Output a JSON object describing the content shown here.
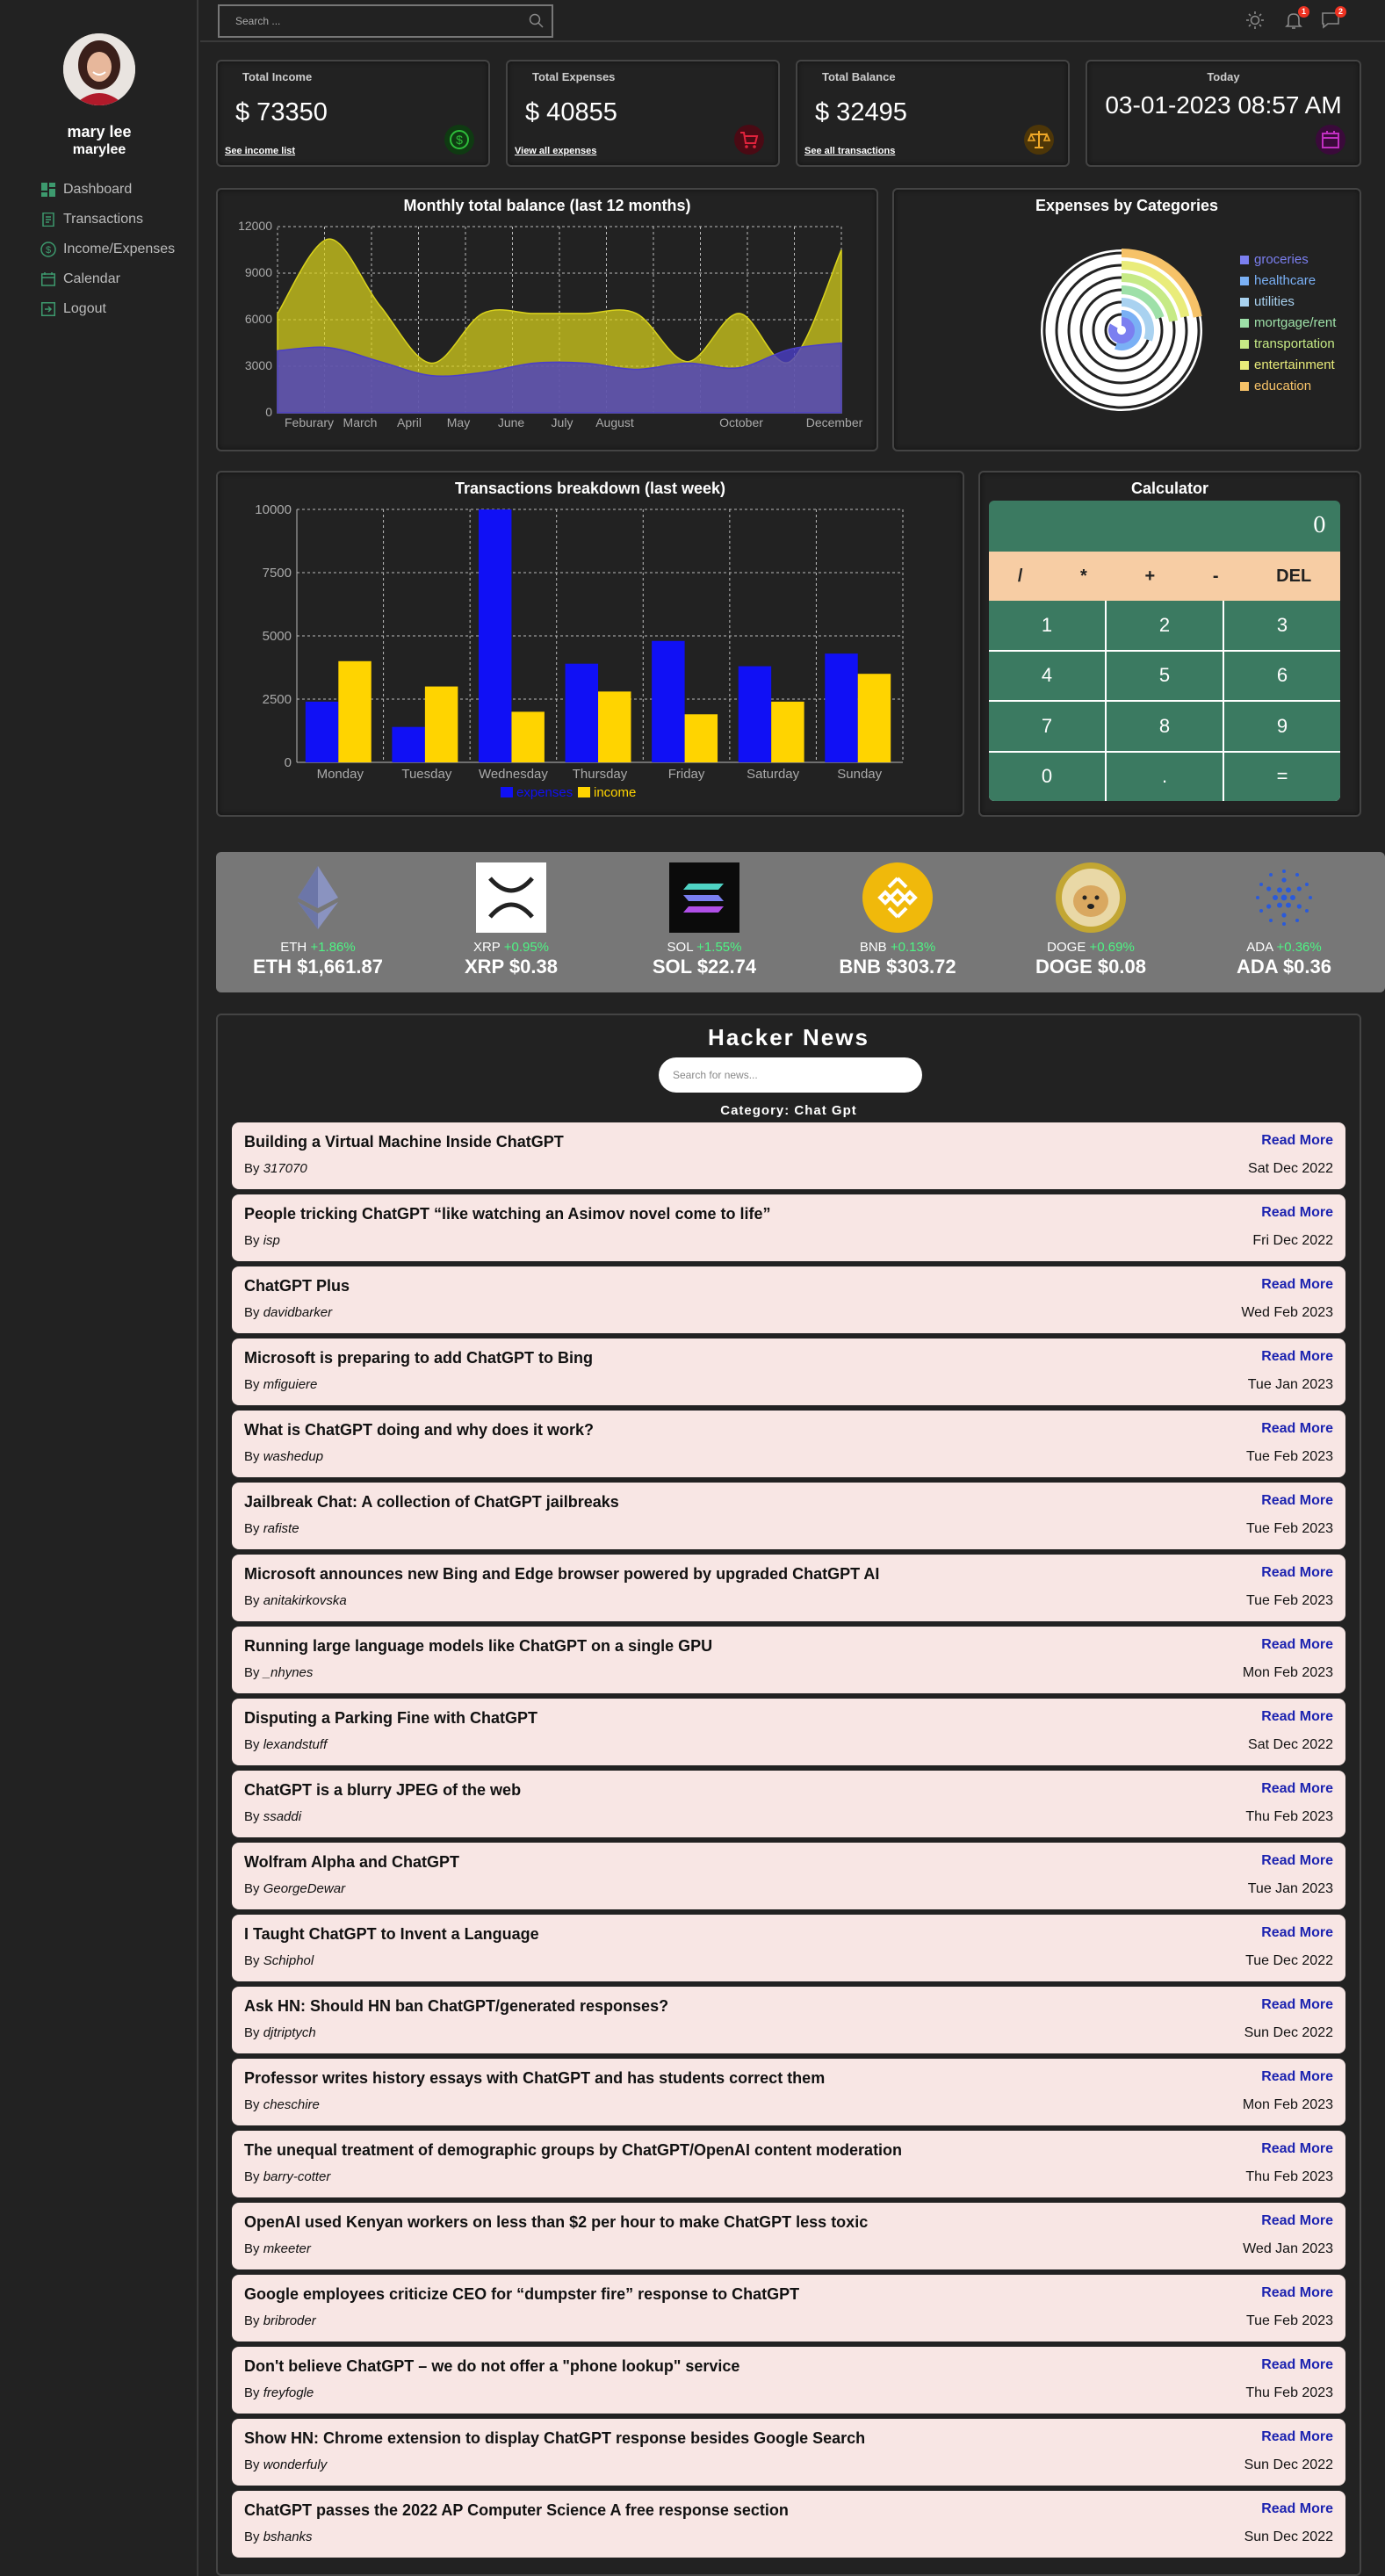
{
  "user": {
    "name": "mary lee",
    "handle": "marylee"
  },
  "sidebar": {
    "items": [
      {
        "label": "Dashboard",
        "icon": "dashboard-icon"
      },
      {
        "label": "Transactions",
        "icon": "receipt-icon"
      },
      {
        "label": "Income/Expenses",
        "icon": "dollar-circle-icon"
      },
      {
        "label": "Calendar",
        "icon": "calendar-icon"
      },
      {
        "label": "Logout",
        "icon": "logout-icon"
      }
    ]
  },
  "topbar": {
    "search_placeholder": "Search ...",
    "notifications_count": "1",
    "messages_count": "2"
  },
  "stats": {
    "income": {
      "title": "Total Income",
      "value": "$ 73350",
      "link": "See income list",
      "color": "#1f8a2a"
    },
    "expenses": {
      "title": "Total Expenses",
      "value": "$ 40855",
      "link": "View all expenses",
      "color": "#b8122b"
    },
    "balance": {
      "title": "Total Balance",
      "value": "$ 32495",
      "link": "See all transactions",
      "color": "#b57c12"
    },
    "today": {
      "title": "Today",
      "value": "03-01-2023 08:57 AM",
      "color": "#8a1a8a"
    }
  },
  "balance_chart": {
    "title": "Monthly total balance (last 12 months)"
  },
  "categories_chart": {
    "title": "Expenses by Categories"
  },
  "transactions_chart": {
    "title": "Transactions breakdown (last week)"
  },
  "chart_data": [
    {
      "type": "area",
      "title": "Monthly total balance (last 12 months)",
      "x": [
        "Feburary",
        "March",
        "April",
        "May",
        "June",
        "July",
        "August",
        "",
        "October",
        "",
        "December"
      ],
      "ylim": [
        0,
        12000
      ],
      "yticks": [
        0,
        3000,
        6000,
        9000,
        12000
      ],
      "grid": true,
      "series": [
        {
          "color": "#d9d21c",
          "values": [
            6400,
            11200,
            6900,
            3200,
            6400,
            6400,
            6400,
            6400,
            3300,
            6400,
            3300,
            10500
          ]
        },
        {
          "color": "#4b3fc7",
          "values": [
            4000,
            4200,
            3300,
            2400,
            2600,
            3200,
            3200,
            2800,
            3200,
            2900,
            4100,
            4500
          ]
        }
      ]
    },
    {
      "type": "pie",
      "title": "Expenses by Categories",
      "legend_position": "right",
      "series": [
        {
          "name": "groceries",
          "color": "#7b7ff0"
        },
        {
          "name": "healthcare",
          "color": "#7ab0f5"
        },
        {
          "name": "utilities",
          "color": "#a9d2f0"
        },
        {
          "name": "mortgage/rent",
          "color": "#9ee0a8"
        },
        {
          "name": "transportation",
          "color": "#c6ea85"
        },
        {
          "name": "entertainment",
          "color": "#e9ec7a"
        },
        {
          "name": "education",
          "color": "#f6c268"
        }
      ]
    },
    {
      "type": "bar",
      "title": "Transactions breakdown (last week)",
      "categories": [
        "Monday",
        "Tuesday",
        "Wednesday",
        "Thursday",
        "Friday",
        "Saturday",
        "Sunday"
      ],
      "ylim": [
        0,
        10000
      ],
      "yticks": [
        0,
        2500,
        5000,
        7500,
        10000
      ],
      "legend_position": "bottom",
      "series": [
        {
          "name": "expenses",
          "color": "#1010f5",
          "values": [
            2400,
            1400,
            10000,
            3900,
            4800,
            3800,
            4300
          ]
        },
        {
          "name": "income",
          "color": "#ffd400",
          "values": [
            4000,
            3000,
            2000,
            2800,
            1900,
            2400,
            3500
          ]
        }
      ]
    }
  ],
  "calculator": {
    "title": "Calculator",
    "display": "0",
    "ops": [
      "/",
      "*",
      "+",
      "-",
      "DEL"
    ],
    "keys": [
      "1",
      "2",
      "3",
      "4",
      "5",
      "6",
      "7",
      "8",
      "9",
      "0",
      ".",
      "="
    ]
  },
  "crypto": [
    {
      "symbol": "ETH",
      "change": "+1.86%",
      "price": "ETH $1,661.87",
      "icon": "ethereum-icon"
    },
    {
      "symbol": "XRP",
      "change": "+0.95%",
      "price": "XRP $0.38",
      "icon": "xrp-icon"
    },
    {
      "symbol": "SOL",
      "change": "+1.55%",
      "price": "SOL $22.74",
      "icon": "solana-icon"
    },
    {
      "symbol": "BNB",
      "change": "+0.13%",
      "price": "BNB $303.72",
      "icon": "bnb-icon"
    },
    {
      "symbol": "DOGE",
      "change": "+0.69%",
      "price": "DOGE $0.08",
      "icon": "doge-icon"
    },
    {
      "symbol": "ADA",
      "change": "+0.36%",
      "price": "ADA $0.36",
      "icon": "cardano-icon"
    }
  ],
  "hacker_news": {
    "title": "Hacker News",
    "search_placeholder": "Search for news...",
    "category": "Category: Chat Gpt",
    "read_more": "Read More",
    "by": "By",
    "items": [
      {
        "title": "Building a Virtual Machine Inside ChatGPT",
        "author": "317070",
        "date": "Sat Dec 2022"
      },
      {
        "title": "People tricking ChatGPT “like watching an Asimov novel come to life”",
        "author": "isp",
        "date": "Fri Dec 2022"
      },
      {
        "title": "ChatGPT Plus",
        "author": "davidbarker",
        "date": "Wed Feb 2023"
      },
      {
        "title": "Microsoft is preparing to add ChatGPT to Bing",
        "author": "mfiguiere",
        "date": "Tue Jan 2023"
      },
      {
        "title": "What is ChatGPT doing and why does it work?",
        "author": "washedup",
        "date": "Tue Feb 2023"
      },
      {
        "title": "Jailbreak Chat: A collection of ChatGPT jailbreaks",
        "author": "rafiste",
        "date": "Tue Feb 2023"
      },
      {
        "title": "Microsoft announces new Bing and Edge browser powered by upgraded ChatGPT AI",
        "author": "anitakirkovska",
        "date": "Tue Feb 2023"
      },
      {
        "title": "Running large language models like ChatGPT on a single GPU",
        "author": "_nhynes",
        "date": "Mon Feb 2023"
      },
      {
        "title": "Disputing a Parking Fine with ChatGPT",
        "author": "lexandstuff",
        "date": "Sat Dec 2022"
      },
      {
        "title": "ChatGPT is a blurry JPEG of the web",
        "author": "ssaddi",
        "date": "Thu Feb 2023"
      },
      {
        "title": "Wolfram Alpha and ChatGPT",
        "author": "GeorgeDewar",
        "date": "Tue Jan 2023"
      },
      {
        "title": "I Taught ChatGPT to Invent a Language",
        "author": "Schiphol",
        "date": "Tue Dec 2022"
      },
      {
        "title": "Ask HN: Should HN ban ChatGPT/generated responses?",
        "author": "djtriptych",
        "date": "Sun Dec 2022"
      },
      {
        "title": "Professor writes history essays with ChatGPT and has students correct them",
        "author": "cheschire",
        "date": "Mon Feb 2023"
      },
      {
        "title": "The unequal treatment of demographic groups by ChatGPT/OpenAI content moderation",
        "author": "barry-cotter",
        "date": "Thu Feb 2023"
      },
      {
        "title": "OpenAI used Kenyan workers on less than $2 per hour to make ChatGPT less toxic",
        "author": "mkeeter",
        "date": "Wed Jan 2023"
      },
      {
        "title": "Google employees criticize CEO for “dumpster fire” response to ChatGPT",
        "author": "bribroder",
        "date": "Tue Feb 2023"
      },
      {
        "title": "Don't believe ChatGPT – we do not offer a \"phone lookup\" service",
        "author": "freyfogle",
        "date": "Thu Feb 2023"
      },
      {
        "title": "Show HN: Chrome extension to display ChatGPT response besides Google Search",
        "author": "wonderfuly",
        "date": "Sun Dec 2022"
      },
      {
        "title": "ChatGPT passes the 2022 AP Computer Science A free response section",
        "author": "bshanks",
        "date": "Sun Dec 2022"
      }
    ]
  }
}
